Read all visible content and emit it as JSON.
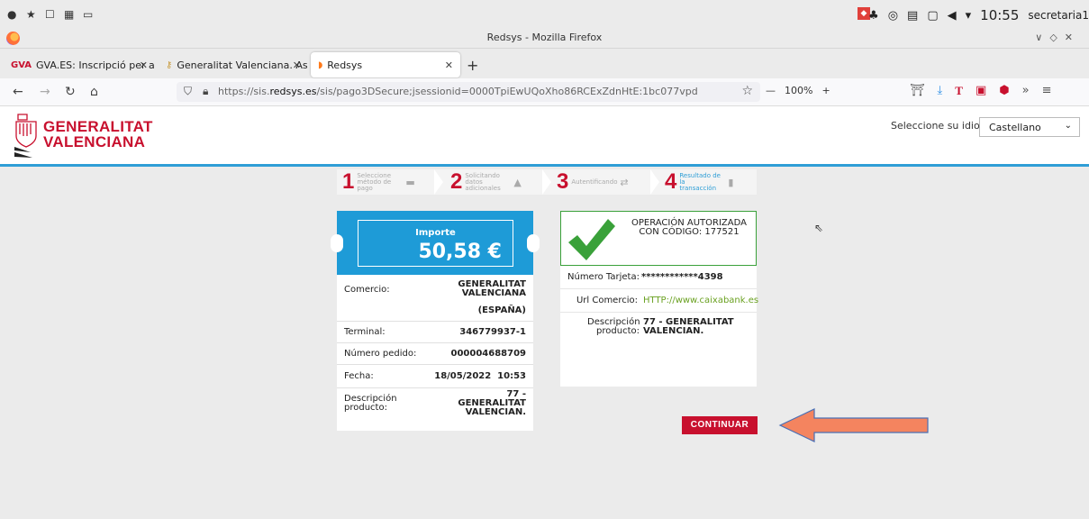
{
  "system": {
    "time": "10:55",
    "user": "secretaria1"
  },
  "window": {
    "title": "Redsys - Mozilla Firefox"
  },
  "tabs": [
    {
      "label": "GVA.ES: Inscripció per a la",
      "icon": "gva-icon"
    },
    {
      "label": "Generalitat Valenciana. Ass",
      "icon": "key-icon"
    },
    {
      "label": "Redsys",
      "icon": "firefox-icon",
      "active": true
    }
  ],
  "nav": {
    "url_prefix": "https://sis.",
    "url_domain": "redsys.es",
    "url_path": "/sis/pago3DSecure;jsessionid=0000TpiEwUQoXho86RCExZdnHtE:1bc077vpd",
    "zoom": "100%"
  },
  "header": {
    "logo_line1": "GENERALITAT",
    "logo_line2": "VALENCIANA",
    "lang_label": "Seleccione su idioma",
    "lang_selected": "Castellano"
  },
  "steps": [
    {
      "num": "1",
      "label": "Seleccione método de pago"
    },
    {
      "num": "2",
      "label": "Solicitando datos adicionales"
    },
    {
      "num": "3",
      "label": "Autentificando"
    },
    {
      "num": "4",
      "label": "Resultado de la transacción"
    }
  ],
  "payment": {
    "importe_label": "Importe",
    "amount": "50,58 €",
    "rows": [
      {
        "k": "Comercio:",
        "v": "GENERALITAT VALENCIANA"
      },
      {
        "k": "",
        "v": "(ESPAÑA)"
      },
      {
        "k": "Terminal:",
        "v": "346779937-1"
      },
      {
        "k": "Número pedido:",
        "v": "000004688709"
      },
      {
        "k": "Fecha:",
        "v": "18/05/2022  10:53"
      },
      {
        "k": "Descripción producto:",
        "v": "77 - GENERALITAT VALENCIAN."
      }
    ]
  },
  "result": {
    "msg": "OPERACIÓN AUTORIZADA CON CÓDIGO: 177521",
    "tarjeta_label": "Número Tarjeta:",
    "tarjeta_value": "************4398",
    "url_label": "Url Comercio:",
    "url_value": "HTTP://www.caixabank.es",
    "desc_label": "Descripción producto:",
    "desc_value": "77 - GENERALITAT VALENCIAN."
  },
  "continue_label": "CONTINUAR",
  "colors": {
    "brand_red": "#c8102e",
    "redsys_blue": "#1e9bd7",
    "success_green": "#3aa13a",
    "annotation_arrow": "#f4845f"
  }
}
